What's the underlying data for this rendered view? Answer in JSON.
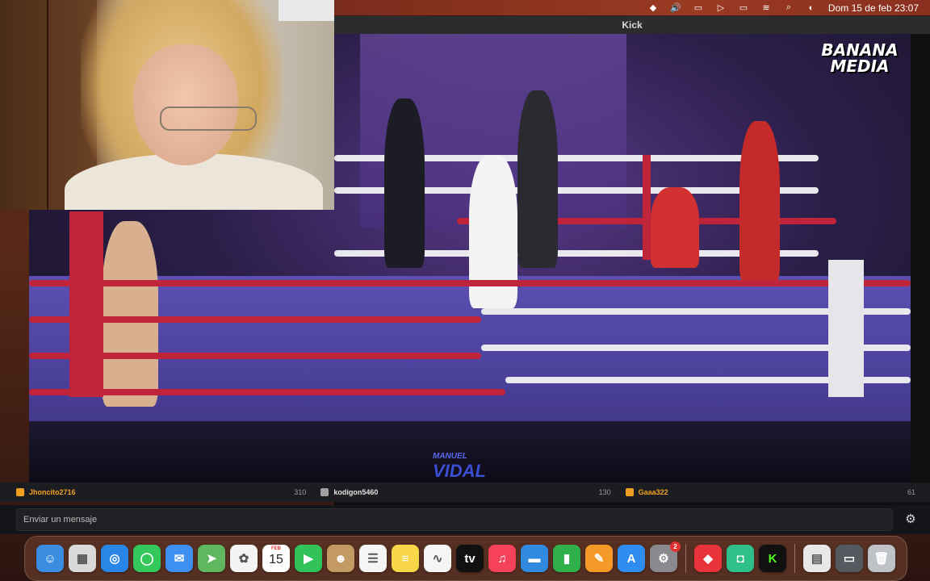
{
  "menubar": {
    "datetime": "Dom 15 de feb  23:07",
    "icons": [
      "dropbox-icon",
      "volume-icon",
      "screen-mirror-icon",
      "play-icon",
      "battery-icon",
      "wifi-icon",
      "search-icon",
      "control-center-icon"
    ]
  },
  "window": {
    "title": "Kick"
  },
  "video": {
    "logo_line1": "BANANA",
    "logo_line2": "MEDIA",
    "watermark_line1": "MANUEL",
    "watermark_line2": "VIDAL"
  },
  "chat": {
    "entries": [
      {
        "user": "Jhoncito2716",
        "count": "310",
        "badge_color": "#f0a020"
      },
      {
        "user": "kodigon5460",
        "count": "130",
        "badge_color": "#a0a0a0"
      },
      {
        "user": "Gaaa322",
        "count": "61",
        "badge_color": "#f0a020"
      }
    ],
    "input_placeholder": "Enviar un mensaje"
  },
  "dock": {
    "calendar_month": "FEB",
    "calendar_day": "15",
    "settings_badge": "2",
    "apps": [
      {
        "name": "finder",
        "color": "#3a8de0",
        "glyph": "☺"
      },
      {
        "name": "launchpad",
        "color": "#d9d9d9",
        "glyph": "▦"
      },
      {
        "name": "safari",
        "color": "#2a86e6",
        "glyph": "◎"
      },
      {
        "name": "messages",
        "color": "#34c759",
        "glyph": "◯"
      },
      {
        "name": "mail",
        "color": "#3d8ff0",
        "glyph": "✉"
      },
      {
        "name": "maps",
        "color": "#5fb85f",
        "glyph": "➤"
      },
      {
        "name": "photos",
        "color": "#f4f4f4",
        "glyph": "✿"
      },
      {
        "name": "calendar",
        "color": "#ffffff",
        "glyph": ""
      },
      {
        "name": "facetime",
        "color": "#32c25a",
        "glyph": "▶"
      },
      {
        "name": "contacts",
        "color": "#c29a62",
        "glyph": "☻"
      },
      {
        "name": "reminders",
        "color": "#f5f5f5",
        "glyph": "☰"
      },
      {
        "name": "notes",
        "color": "#f7d64a",
        "glyph": "≡"
      },
      {
        "name": "freeform",
        "color": "#f5f5f5",
        "glyph": "∿"
      },
      {
        "name": "appletv",
        "color": "#111111",
        "glyph": "tv"
      },
      {
        "name": "music",
        "color": "#f5425a",
        "glyph": "♫"
      },
      {
        "name": "keynote",
        "color": "#2f8ae0",
        "glyph": "▬"
      },
      {
        "name": "numbers",
        "color": "#30b04a",
        "glyph": "▮"
      },
      {
        "name": "pages",
        "color": "#f59a28",
        "glyph": "✎"
      },
      {
        "name": "appstore",
        "color": "#2f8cf0",
        "glyph": "A"
      },
      {
        "name": "system-settings",
        "color": "#8a8a8e",
        "glyph": "⚙"
      },
      {
        "name": "anydesk",
        "color": "#e8333a",
        "glyph": "◆"
      },
      {
        "name": "obs-or-app",
        "color": "#2fbf88",
        "glyph": "◘"
      },
      {
        "name": "kick",
        "color": "#111111",
        "glyph": "K"
      },
      {
        "name": "preview",
        "color": "#e8e8e8",
        "glyph": "▤"
      },
      {
        "name": "screen-recording",
        "color": "#555a60",
        "glyph": "▭"
      },
      {
        "name": "trash",
        "color": "#bfc3c8",
        "glyph": "🗑"
      }
    ]
  }
}
